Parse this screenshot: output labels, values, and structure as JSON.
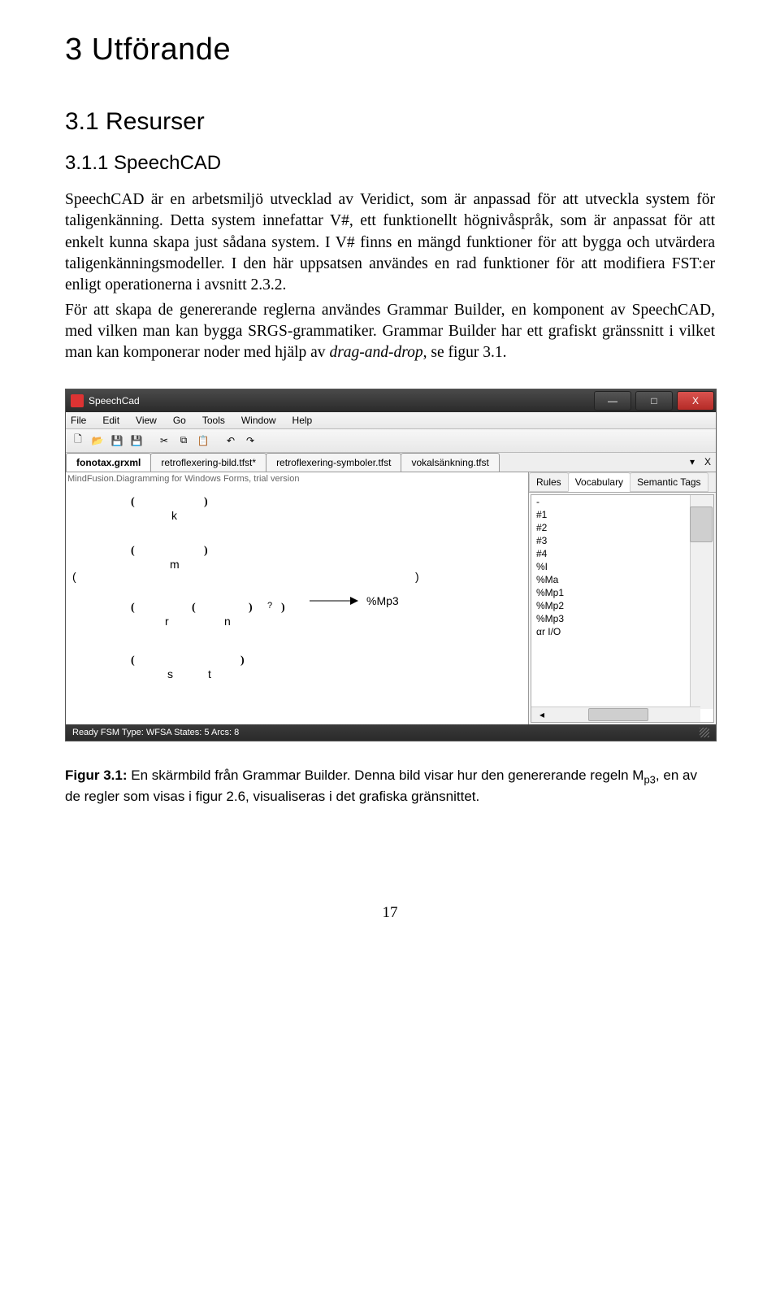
{
  "headings": {
    "h1": "3   Utförande",
    "h2": "3.1   Resurser",
    "h3": "3.1.1   SpeechCAD"
  },
  "paragraph": "SpeechCAD är en arbetsmiljö utvecklad av Veridict, som är anpassad för att utveckla system för taligenkänning. Detta system innefattar V#, ett funktionellt högnivåspråk, som är anpassat för att enkelt kunna skapa just sådana system. I V# finns en mängd funktioner för att bygga och utvärdera taligenkänningsmodeller. I den här uppsatsen användes en rad funktioner för att modifiera FST:er enligt operationerna i avsnitt 2.3.2.",
  "paragraph2": "För att skapa de genererande reglerna användes Grammar Builder, en komponent av SpeechCAD, med vilken man kan bygga SRGS-grammatiker. Grammar Builder har ett grafiskt gränssnitt i vilket man kan komponerar noder med hjälp av drag-and-drop, se figur 3.1.",
  "app": {
    "title": "SpeechCad",
    "menubar": [
      "File",
      "Edit",
      "View",
      "Go",
      "Tools",
      "Window",
      "Help"
    ],
    "tabs": [
      "fonotax.grxml",
      "retroflexering-bild.tfst*",
      "retroflexering-symboler.tfst",
      "vokalsänkning.tfst"
    ],
    "watermark": "MindFusion.Diagramming for Windows Forms, trial version",
    "sidetabs": [
      "Rules",
      "Vocabulary",
      "Semantic Tags"
    ],
    "vocab": [
      "-",
      "#1",
      "#2",
      "#3",
      "#4",
      "%I",
      "%Ma",
      "%Mp1",
      "%Mp2",
      "%Mp3",
      "αr I/O"
    ],
    "status": "Ready  FSM Type: WFSA  States: 5  Arcs: 8",
    "grammar": {
      "k": "k",
      "m": "m",
      "r": "r",
      "n": "n",
      "s": "s",
      "t": "t",
      "rule": "%Mp3",
      "q": "?"
    }
  },
  "caption_label": "Figur 3.1:",
  "caption_text1": " En skärmbild från Grammar Builder. Denna bild visar hur den genererande regeln M",
  "caption_sub": "p3",
  "caption_text2": ", en av de regler som visas i figur 2.6, visualiseras i det grafiska gränsnittet.",
  "pagenum": "17"
}
